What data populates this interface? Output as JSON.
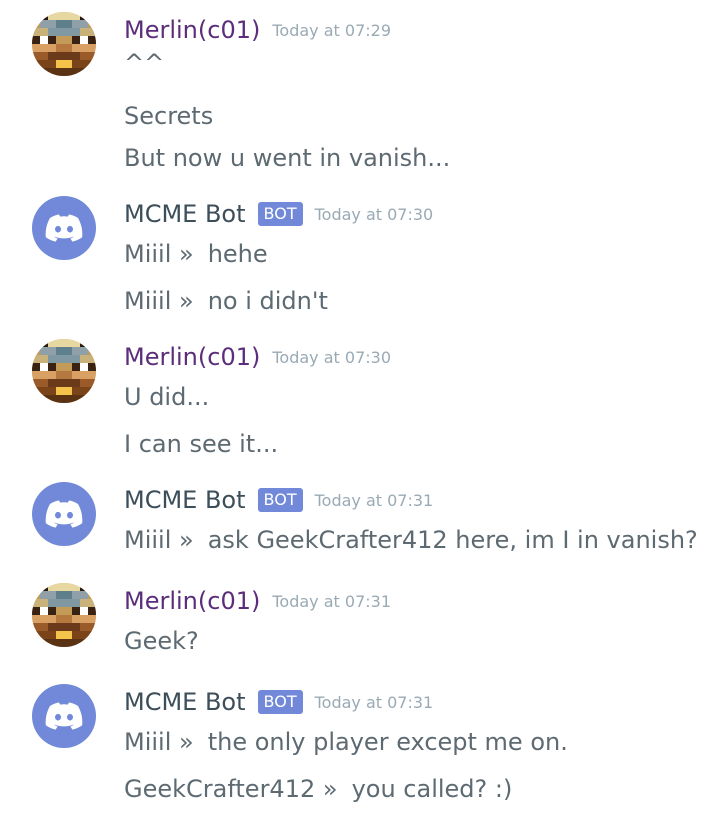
{
  "colors": {
    "merlin_name": "#5b2d7a",
    "bot_name": "#3c4e5a",
    "bot_tag": "#7289da",
    "timestamp": "#99aab5",
    "message_text": "#5d6a72"
  },
  "messages": [
    {
      "author": "Merlin(c01)",
      "is_bot": false,
      "timestamp": "Today at 07:29",
      "avatar_icon": "minecraft-skin-avatar",
      "lines": [
        {
          "text": "^^"
        },
        {
          "text": "Secrets"
        },
        {
          "text": "But now u went in vanish..."
        }
      ]
    },
    {
      "author": "MCME Bot",
      "is_bot": true,
      "bot_tag": "BOT",
      "timestamp": "Today at 07:30",
      "avatar_icon": "discord-logo-icon",
      "lines": [
        {
          "speaker": "Miiil »",
          "text": "hehe"
        },
        {
          "speaker": "Miiil »",
          "text": "no i didn't"
        }
      ]
    },
    {
      "author": "Merlin(c01)",
      "is_bot": false,
      "timestamp": "Today at 07:30",
      "avatar_icon": "minecraft-skin-avatar",
      "lines": [
        {
          "text": "U did..."
        },
        {
          "text": "I can see it..."
        }
      ]
    },
    {
      "author": "MCME Bot",
      "is_bot": true,
      "bot_tag": "BOT",
      "timestamp": "Today at 07:31",
      "avatar_icon": "discord-logo-icon",
      "lines": [
        {
          "speaker": "Miiil »",
          "text": "ask GeekCrafter412 here, im I in vanish?"
        }
      ]
    },
    {
      "author": "Merlin(c01)",
      "is_bot": false,
      "timestamp": "Today at 07:31",
      "avatar_icon": "minecraft-skin-avatar",
      "lines": [
        {
          "text": "Geek?"
        }
      ]
    },
    {
      "author": "MCME Bot",
      "is_bot": true,
      "bot_tag": "BOT",
      "timestamp": "Today at 07:31",
      "avatar_icon": "discord-logo-icon",
      "lines": [
        {
          "speaker": "Miiil »",
          "text": "the only player except me on."
        },
        {
          "speaker": "GeekCrafter412 »",
          "text": "you called? :)"
        }
      ]
    }
  ]
}
